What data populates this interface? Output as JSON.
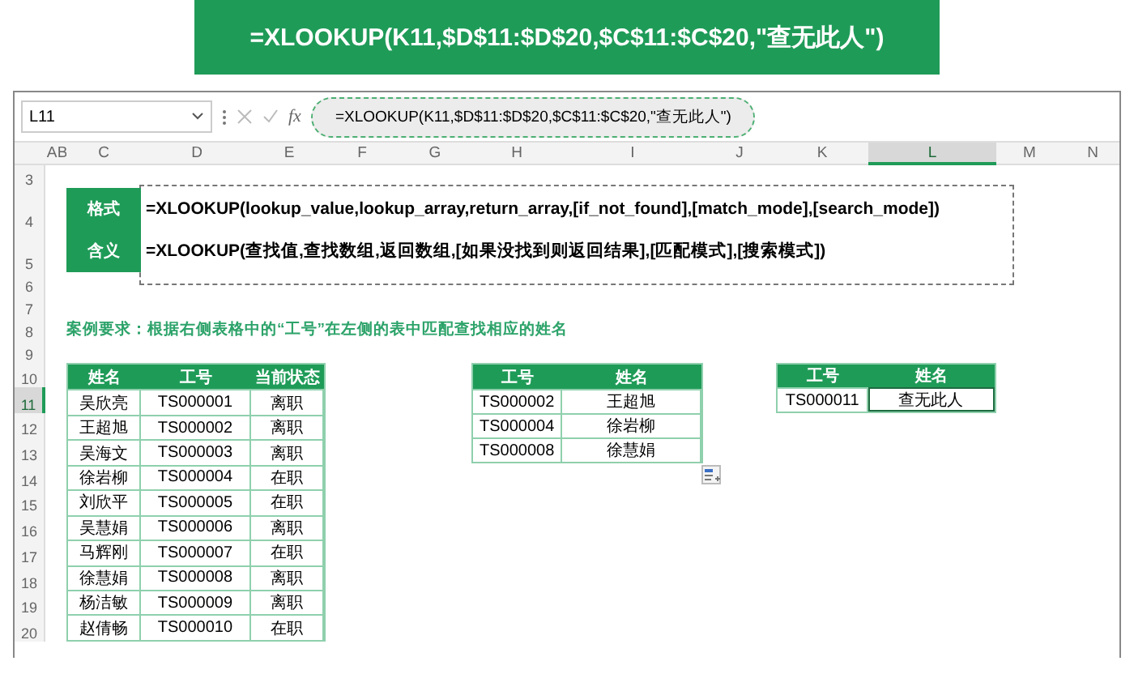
{
  "banner": {
    "formula": "=XLOOKUP(K11,$D$11:$D$20,$C$11:$C$20,\"查无此人\")"
  },
  "formula_bar": {
    "name_box": "L11",
    "fx": "fx",
    "formula": "=XLOOKUP(K11,$D$11:$D$20,$C$11:$C$20,\"查无此人\")"
  },
  "columns": [
    {
      "label": "A",
      "selected": false
    },
    {
      "label": "B",
      "selected": false
    },
    {
      "label": "C",
      "selected": false
    },
    {
      "label": "D",
      "selected": false
    },
    {
      "label": "E",
      "selected": false
    },
    {
      "label": "F",
      "selected": false
    },
    {
      "label": "G",
      "selected": false
    },
    {
      "label": "H",
      "selected": false
    },
    {
      "label": "I",
      "selected": false
    },
    {
      "label": "J",
      "selected": false
    },
    {
      "label": "K",
      "selected": false
    },
    {
      "label": "L",
      "selected": true
    },
    {
      "label": "M",
      "selected": false
    },
    {
      "label": "N",
      "selected": false
    }
  ],
  "rows": [
    {
      "label": "3",
      "selected": false
    },
    {
      "label": "4",
      "selected": false
    },
    {
      "label": "5",
      "selected": false
    },
    {
      "label": "6",
      "selected": false
    },
    {
      "label": "7",
      "selected": false
    },
    {
      "label": "8",
      "selected": false
    },
    {
      "label": "9",
      "selected": false
    },
    {
      "label": "10",
      "selected": false
    },
    {
      "label": "11",
      "selected": true
    },
    {
      "label": "12",
      "selected": false
    },
    {
      "label": "13",
      "selected": false
    },
    {
      "label": "14",
      "selected": false
    },
    {
      "label": "15",
      "selected": false
    },
    {
      "label": "16",
      "selected": false
    },
    {
      "label": "17",
      "selected": false
    },
    {
      "label": "18",
      "selected": false
    },
    {
      "label": "19",
      "selected": false
    },
    {
      "label": "20",
      "selected": false
    }
  ],
  "syntax": [
    {
      "label": "格式",
      "text": "=XLOOKUP(lookup_value,lookup_array,return_array,[if_not_found],[match_mode],[search_mode])"
    },
    {
      "label": "含义",
      "text": "=XLOOKUP(查找值,查找数组,返回数组,[如果没找到则返回结果],[匹配模式],[搜索模式])"
    }
  ],
  "requirement": "案例要求：根据右侧表格中的“工号”在左侧的表中匹配查找相应的姓名",
  "tables": [
    {
      "columns": [
        "姓名",
        "工号",
        "当前状态"
      ],
      "rows": [
        {
          "cells": [
            {
              "text": "吴欣亮",
              "selected": false
            },
            {
              "text": "TS000001",
              "selected": false
            },
            {
              "text": "离职",
              "selected": false
            }
          ]
        },
        {
          "cells": [
            {
              "text": "王超旭",
              "selected": false
            },
            {
              "text": "TS000002",
              "selected": false
            },
            {
              "text": "离职",
              "selected": false
            }
          ]
        },
        {
          "cells": [
            {
              "text": "吴海文",
              "selected": false
            },
            {
              "text": "TS000003",
              "selected": false
            },
            {
              "text": "离职",
              "selected": false
            }
          ]
        },
        {
          "cells": [
            {
              "text": "徐岩柳",
              "selected": false
            },
            {
              "text": "TS000004",
              "selected": false
            },
            {
              "text": "在职",
              "selected": false
            }
          ]
        },
        {
          "cells": [
            {
              "text": "刘欣平",
              "selected": false
            },
            {
              "text": "TS000005",
              "selected": false
            },
            {
              "text": "在职",
              "selected": false
            }
          ]
        },
        {
          "cells": [
            {
              "text": "吴慧娟",
              "selected": false
            },
            {
              "text": "TS000006",
              "selected": false
            },
            {
              "text": "离职",
              "selected": false
            }
          ]
        },
        {
          "cells": [
            {
              "text": "马辉刚",
              "selected": false
            },
            {
              "text": "TS000007",
              "selected": false
            },
            {
              "text": "在职",
              "selected": false
            }
          ]
        },
        {
          "cells": [
            {
              "text": "徐慧娟",
              "selected": false
            },
            {
              "text": "TS000008",
              "selected": false
            },
            {
              "text": "离职",
              "selected": false
            }
          ]
        },
        {
          "cells": [
            {
              "text": "杨洁敏",
              "selected": false
            },
            {
              "text": "TS000009",
              "selected": false
            },
            {
              "text": "离职",
              "selected": false
            }
          ]
        },
        {
          "cells": [
            {
              "text": "赵倩畅",
              "selected": false
            },
            {
              "text": "TS000010",
              "selected": false
            },
            {
              "text": "在职",
              "selected": false
            }
          ]
        }
      ]
    },
    {
      "columns": [
        "工号",
        "姓名"
      ],
      "rows": [
        {
          "cells": [
            {
              "text": "TS000002",
              "selected": false
            },
            {
              "text": "王超旭",
              "selected": false
            }
          ]
        },
        {
          "cells": [
            {
              "text": "TS000004",
              "selected": false
            },
            {
              "text": "徐岩柳",
              "selected": false
            }
          ]
        },
        {
          "cells": [
            {
              "text": "TS000008",
              "selected": false
            },
            {
              "text": "徐慧娟",
              "selected": false
            }
          ]
        }
      ]
    },
    {
      "columns": [
        "工号",
        "姓名"
      ],
      "rows": [
        {
          "cells": [
            {
              "text": "TS000011",
              "selected": false
            },
            {
              "text": "查无此人",
              "selected": true
            }
          ]
        }
      ]
    }
  ]
}
